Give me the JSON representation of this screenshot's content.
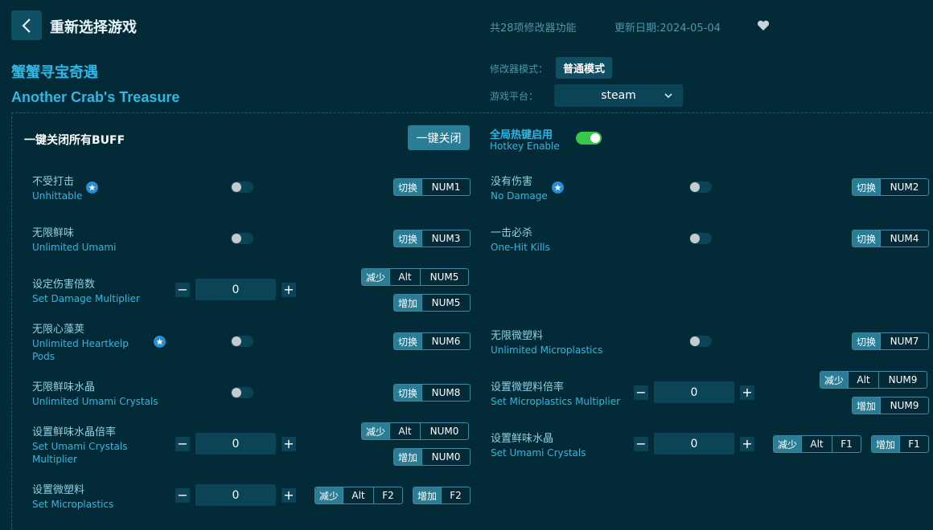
{
  "header": {
    "title": "重新选择游戏",
    "feature_count": "共28项修改器功能",
    "update_date": "更新日期:2024-05-04"
  },
  "game": {
    "name_cn": "蟹蟹寻宝奇遇",
    "name_en": "Another Crab's Treasure"
  },
  "settings": {
    "mode_label": "修改器模式：",
    "mode_value": "普通模式",
    "platform_label": "游戏平台：",
    "platform_value": "steam"
  },
  "global": {
    "buff_label": "一键关闭所有BUFF",
    "close_all_button": "一键关闭",
    "hotkey_cn": "全局热键启用",
    "hotkey_en": "Hotkey Enable",
    "hotkey_enabled": true
  },
  "features": {
    "f1": {
      "cn": "不受打击",
      "en": "Unhittable",
      "on": false,
      "act": "切换",
      "key": "NUM1"
    },
    "f2": {
      "cn": "没有伤害",
      "en": "No Damage",
      "on": false,
      "act": "切换",
      "key": "NUM2"
    },
    "f3": {
      "cn": "无限鲜味",
      "en": "Unlimited Umami",
      "on": false,
      "act": "切换",
      "key": "NUM3"
    },
    "f4": {
      "cn": "一击必杀",
      "en": "One-Hit Kills",
      "on": false,
      "act": "切换",
      "key": "NUM4"
    },
    "f5": {
      "cn": "设定伤害倍数",
      "en": "Set Damage Multiplier",
      "value": "0",
      "dec": "减少",
      "inc": "增加",
      "mod": "Alt",
      "dec_key": "NUM5",
      "inc_key": "NUM5"
    },
    "f6": {
      "cn": "无限心藻荚",
      "en1": "Unlimited Heartkelp",
      "en2": "Pods",
      "on": false,
      "act": "切换",
      "key": "NUM6"
    },
    "f7": {
      "cn": "无限微塑料",
      "en": "Unlimited Microplastics",
      "on": false,
      "act": "切换",
      "key": "NUM7"
    },
    "f8": {
      "cn": "无限鲜味水晶",
      "en": "Unlimited Umami Crystals",
      "on": false,
      "act": "切换",
      "key": "NUM8"
    },
    "f9": {
      "cn": "设置微塑料倍率",
      "en": "Set Microplastics Multiplier",
      "value": "0",
      "dec": "减少",
      "inc": "增加",
      "mod": "Alt",
      "dec_key": "NUM9",
      "inc_key": "NUM9"
    },
    "f10": {
      "cn": "设置鲜味水晶倍率",
      "en1": "Set Umami Crystals",
      "en2": "Multiplier",
      "value": "0",
      "dec": "减少",
      "inc": "增加",
      "mod": "Alt",
      "dec_key": "NUM0",
      "inc_key": "NUM0"
    },
    "f11": {
      "cn": "设置鲜味水晶",
      "en": "Set Umami Crystals",
      "value": "0",
      "dec": "减少",
      "inc": "增加",
      "mod": "Alt",
      "dec_key": "F1",
      "inc_key": "F1"
    },
    "f12": {
      "cn": "设置微塑料",
      "en": "Set Microplastics",
      "value": "0",
      "dec": "减少",
      "inc": "增加",
      "mod": "Alt",
      "dec_key": "F2",
      "inc_key": "F2"
    }
  },
  "stepper": {
    "minus": "−",
    "plus": "+"
  },
  "colors": {
    "background": "#022a37",
    "accent": "#2fb6e3",
    "toggle_on": "#34c94a",
    "chip_action": "#2b7d95"
  }
}
